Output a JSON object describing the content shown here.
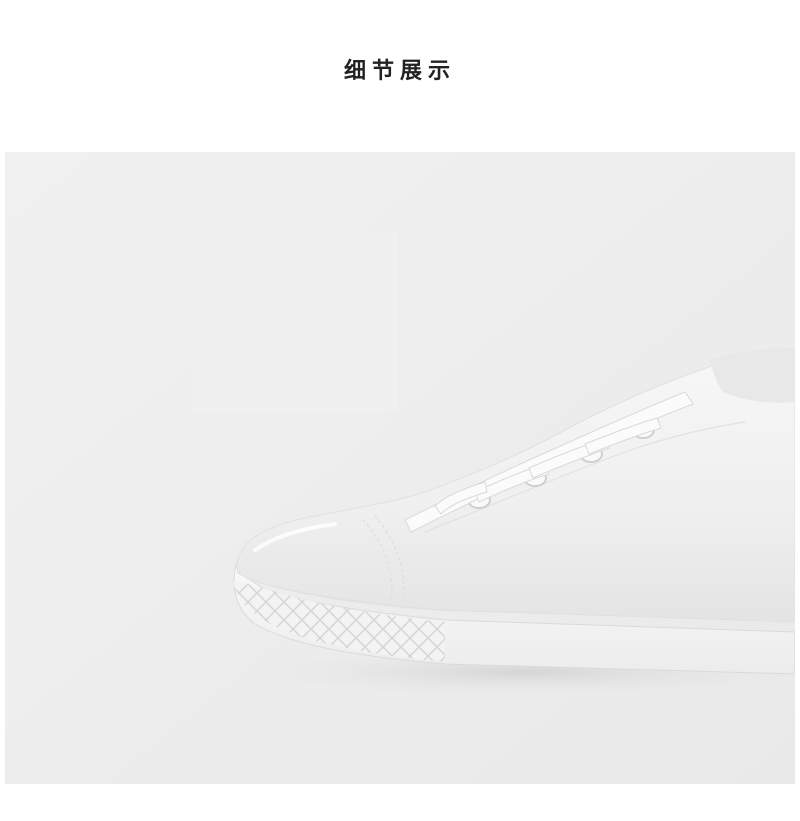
{
  "header": {
    "title": "细节展示"
  },
  "photo": {
    "subject": "shoe-detail-photo",
    "background_color": "#eeeeee",
    "shoe_color": "#f4f4f4"
  }
}
